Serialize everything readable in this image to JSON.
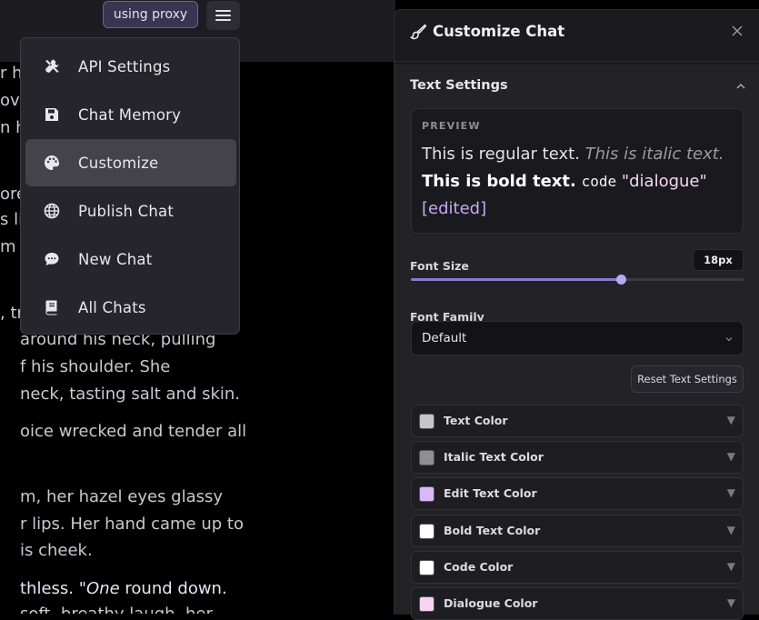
{
  "topbar": {
    "proxy_label": "using proxy"
  },
  "menu": {
    "items": [
      {
        "label": "API Settings",
        "icon": "tools-icon"
      },
      {
        "label": "Chat Memory",
        "icon": "save-icon"
      },
      {
        "label": "Customize",
        "icon": "palette-icon",
        "active": true
      },
      {
        "label": "Publish Chat",
        "icon": "globe-icon"
      },
      {
        "label": "New Chat",
        "icon": "chat-bubble-icon"
      },
      {
        "label": "All Chats",
        "icon": "book-icon"
      }
    ]
  },
  "story": {
    "lines": [
      {
        "text": "r hi"
      },
      {
        "text": "ove"
      },
      {
        "text": "n his"
      },
      {
        "text": "ore"
      },
      {
        "text": "s li"
      },
      {
        "text": "m s"
      },
      {
        "text": ", tr"
      },
      {
        "text": " around his neck, pulling"
      },
      {
        "text": "f his shoulder. She"
      },
      {
        "text": "neck, tasting salt and skin."
      },
      {
        "text": "oice wrecked and tender all"
      },
      {
        "text": "m, her hazel eyes glassy"
      },
      {
        "text": "r lips. Her hand came up to"
      },
      {
        "text": "is cheek."
      },
      {
        "pre": "thless. \"",
        "em": "One",
        "post": " round down."
      },
      {
        "text": "soft, breathy laugh, her"
      }
    ]
  },
  "panel": {
    "title": "Customize Chat",
    "section_title": "Text Settings",
    "preview": {
      "label": "PREVIEW",
      "regular": "This is regular text.",
      "italic": "This is italic text.",
      "bold": "This is bold text.",
      "code": "code",
      "dialogue": "\"dialogue\"",
      "edited": "[edited]"
    },
    "font_size": {
      "label": "Font Size",
      "value": "18px",
      "fraction": 0.63
    },
    "font_family": {
      "label": "Font Family",
      "value": "Default"
    },
    "reset_label": "Reset Text Settings",
    "colors": [
      {
        "label": "Text Color",
        "swatch": "#c6c6c9"
      },
      {
        "label": "Italic Text Color",
        "swatch": "#8f8f93"
      },
      {
        "label": "Edit Text Color",
        "swatch": "#d9b8f8"
      },
      {
        "label": "Bold Text Color",
        "swatch": "#ffffff"
      },
      {
        "label": "Code Color",
        "swatch": "#ffffff"
      },
      {
        "label": "Dialogue Color",
        "swatch": "#f6d3f3"
      }
    ]
  }
}
